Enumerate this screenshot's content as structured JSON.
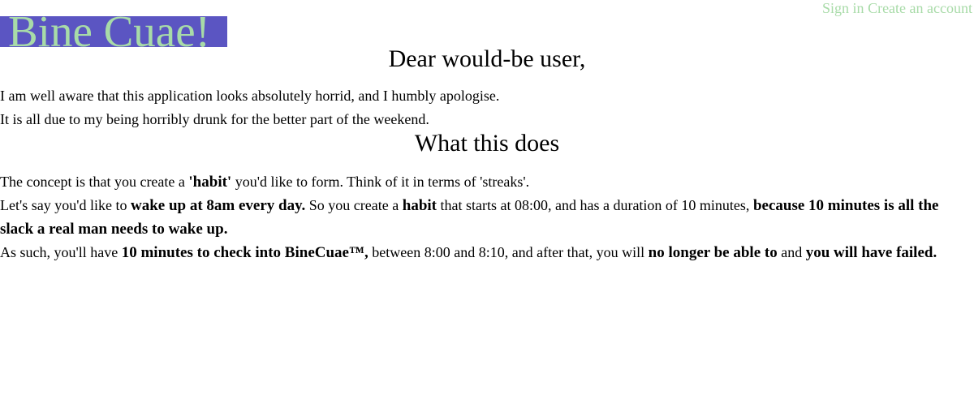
{
  "header": {
    "logo_text": "Bine Cuae!",
    "sign_in": "Sign in",
    "create_account": "Create an account"
  },
  "greeting": {
    "heading": "Dear would-be user,",
    "line1": "I am well aware that this application looks absolutely horrid, and I humbly apologise.",
    "line2": "It is all due to my being horribly drunk for the better part of the weekend."
  },
  "about": {
    "heading": "What this does",
    "line1_a": "The concept is that you create a ",
    "line1_b": "'habit'",
    "line1_c": " you'd like to form. Think of it in terms of 'streaks'.",
    "line2_a": "Let's say you'd like to ",
    "line2_b": "wake up at 8am every day.",
    "line2_c": " So you create a ",
    "line2_d": "habit",
    "line2_e": " that starts at 08:00, and has a duration of 10 minutes, ",
    "line2_f": "because 10 minutes is all the slack a real man needs to wake up.",
    "line3_a": "As such, you'll have ",
    "line3_b": "10 minutes to check into BineCuae™,",
    "line3_c": " between 8:00 and 8:10, and after that, you will ",
    "line3_d": "no longer be able to",
    "line3_e": " and ",
    "line3_f": "you will have failed."
  },
  "colors": {
    "logo_background": "#5b55c2",
    "logo_text": "#a8dba8",
    "nav_link": "#a8dba8"
  }
}
